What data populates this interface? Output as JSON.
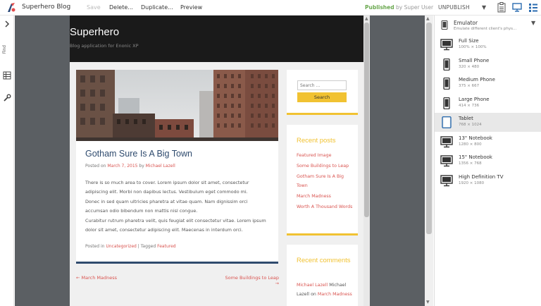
{
  "toolbar": {
    "app_title": "Superhero Blog",
    "save_label": "Save",
    "delete_label": "Delete...",
    "duplicate_label": "Duplicate...",
    "preview_label": "Preview",
    "status_published": "Published",
    "status_by": "by Super User",
    "unpublish_label": "UNPUBLISH",
    "dropdown_glyph": "▼"
  },
  "leftrail": {
    "find_label": "Find"
  },
  "site": {
    "title": "Superhero",
    "subtitle": "Blog application for Enonic XP",
    "post": {
      "title": "Gotham Sure Is A Big Town",
      "meta_prefix": "Posted on",
      "date": "March 7, 2015",
      "by": "by",
      "author": "Michael Lazell",
      "body_1": "There is so much area to cover. Lorem ipsum dolor sit amet, consectetur adipiscing elit. Morbi non dapibus lectus. Vestibulum eget commodo mi.",
      "body_2": "Donec in sed quam ultricies pharetra at vitae quam. Nam dignissim orci accumsan odio bibendum non mattis nisl congue.",
      "body_3": "Curabitur rutrum pharetra velit, quis feugiat elit consectetur vitae. Lorem ipsum dolor sit amet, consectetur adipiscing elit. Maecenas in interdum orci.",
      "footer_prefix": "Posted in",
      "category": "Uncategorized",
      "separator": "|",
      "tagged": "Tagged",
      "tag": "Featured"
    },
    "nav": {
      "prev": "← March Madness",
      "next": "Some Buildings to Leap →"
    },
    "search": {
      "placeholder": "Search ...",
      "button": "Search"
    },
    "recent_posts": {
      "title": "Recent posts",
      "items": [
        "Featured Image",
        "Some Buildings to Leap",
        "Gotham Sure Is A Big Town",
        "March Madness",
        "Worth A Thousand Words"
      ]
    },
    "recent_comments": {
      "title": "Recent comments",
      "author": "Michael Lazell",
      "author2": "Michael Lazell",
      "on": "on",
      "post": "March Madness"
    }
  },
  "emulator": {
    "title": "Emulator",
    "description": "Emulate different client's phys...",
    "chevron": "▼",
    "devices": [
      {
        "name": "Full Size",
        "size": "100% × 100%",
        "icon": "monitor-icon"
      },
      {
        "name": "Small Phone",
        "size": "320 × 480",
        "icon": "phone-icon"
      },
      {
        "name": "Medium Phone",
        "size": "375 × 667",
        "icon": "phone-icon"
      },
      {
        "name": "Large Phone",
        "size": "414 × 736",
        "icon": "phone-icon"
      },
      {
        "name": "Tablet",
        "size": "768 × 1024",
        "icon": "tablet-icon"
      },
      {
        "name": "13\" Notebook",
        "size": "1280 × 800",
        "icon": "monitor-icon"
      },
      {
        "name": "15\" Notebook",
        "size": "1356 × 768",
        "icon": "monitor-icon"
      },
      {
        "name": "High Definition TV",
        "size": "1920 × 1080",
        "icon": "monitor-icon"
      }
    ],
    "selected_index": 4
  },
  "colors": {
    "accent_yellow": "#f1c232",
    "link_red": "#d9534f",
    "title_blue": "#2f4b6e",
    "published_green": "#6aa84f"
  }
}
